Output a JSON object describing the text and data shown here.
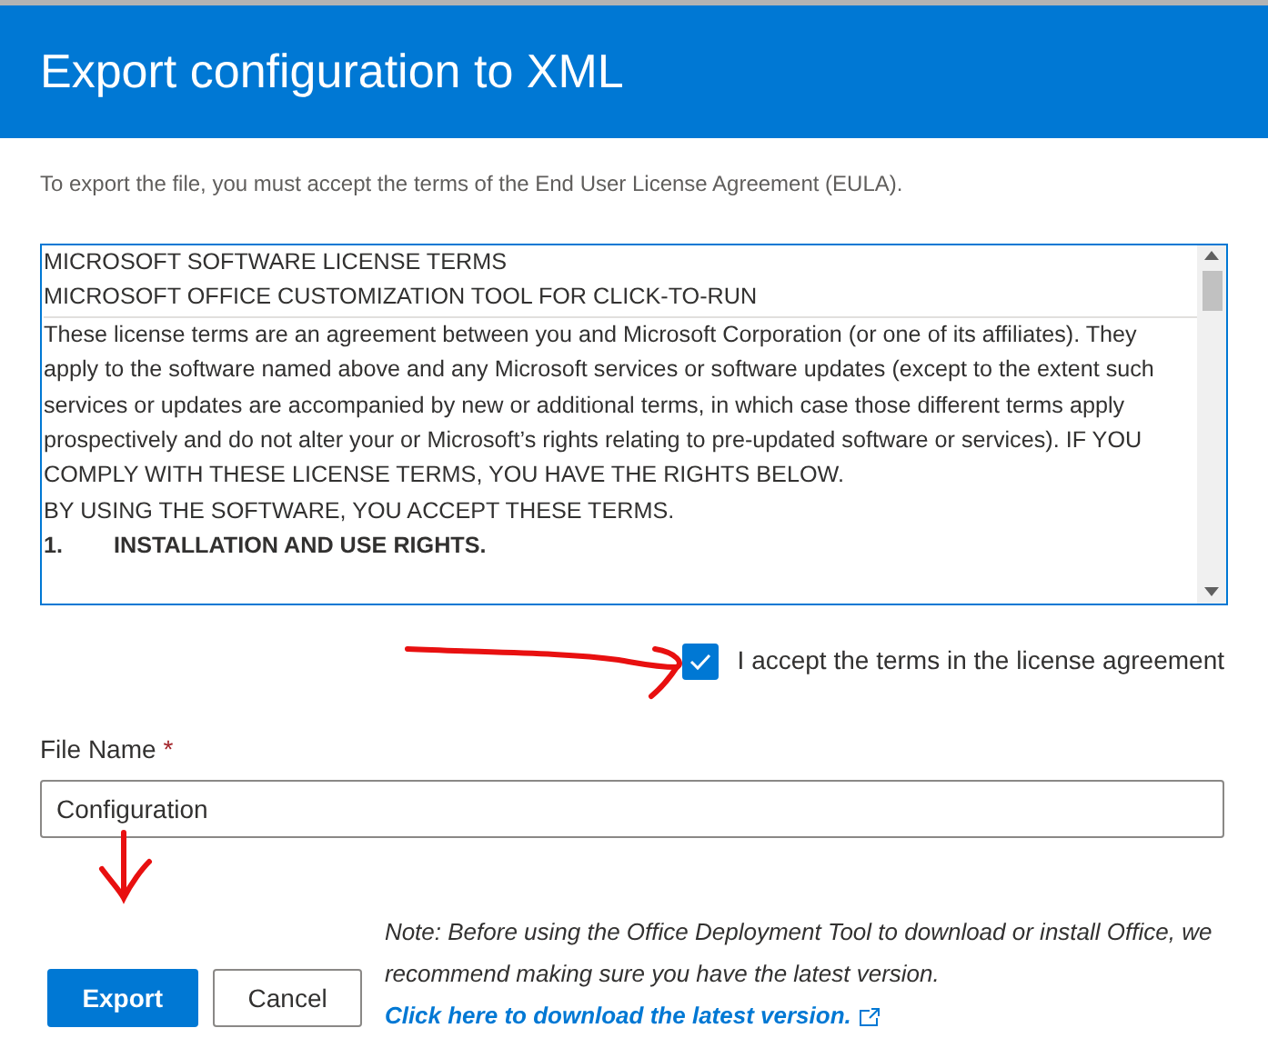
{
  "dialog": {
    "title": "Export configuration to XML"
  },
  "intro": "To export the file, you must accept the terms of the End User License Agreement (EULA).",
  "license": {
    "header_lines": [
      "MICROSOFT SOFTWARE LICENSE TERMS",
      "MICROSOFT OFFICE CUSTOMIZATION TOOL FOR CLICK-TO-RUN"
    ],
    "paragraphs": [
      "These license terms are an agreement between you and Microsoft Corporation (or one of its affiliates). They apply to the software named above and any Microsoft services or software updates (except to the extent such services or updates are accompanied by new or additional terms, in which case those different terms apply prospectively and do not alter your or Microsoft’s rights relating to pre-updated software or services). IF YOU COMPLY WITH THESE LICENSE TERMS, YOU HAVE THE RIGHTS BELOW.",
      "BY USING THE SOFTWARE, YOU ACCEPT THESE TERMS."
    ],
    "section_heading": {
      "number": "1.",
      "text": "INSTALLATION AND USE RIGHTS."
    }
  },
  "accept": {
    "label": "I accept the terms in the license agreement",
    "checked": true
  },
  "file_name": {
    "label": "File Name",
    "required_mark": "*",
    "value": "Configuration"
  },
  "buttons": [
    {
      "label": "Export",
      "kind": "primary"
    },
    {
      "label": "Cancel",
      "kind": "secondary"
    }
  ],
  "note": {
    "text": "Note: Before using the Office Deployment Tool to download or install Office, we recommend making sure you have the latest version.",
    "link": "Click here to download the latest version."
  }
}
